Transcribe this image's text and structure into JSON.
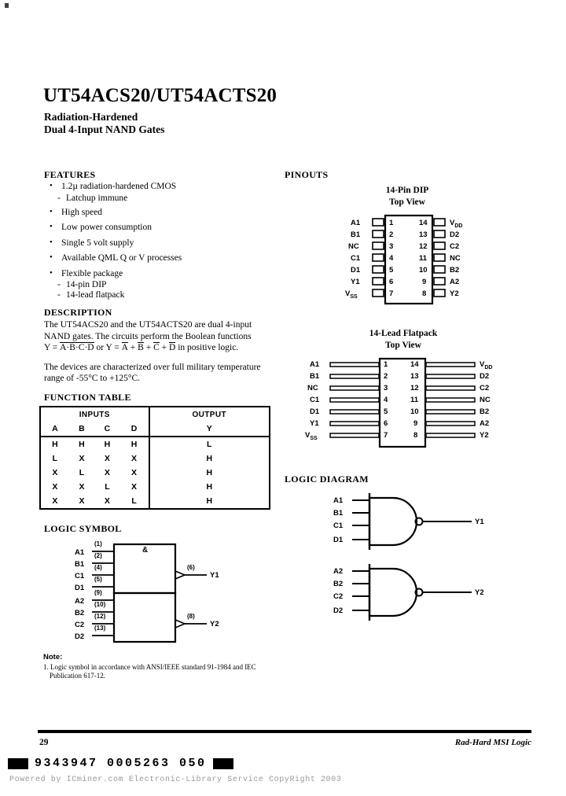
{
  "document": {
    "title": "UT54ACS20/UT54ACTS20",
    "subtitle_line1": "Radiation-Hardened",
    "subtitle_line2": "Dual 4-Input NAND Gates"
  },
  "features": {
    "heading": "FEATURES",
    "items": [
      {
        "text": "1.2µ radiation-hardened CMOS",
        "level": 0
      },
      {
        "text": "Latchup immune",
        "level": 1
      },
      {
        "text": "High speed",
        "level": 0
      },
      {
        "text": "Low power consumption",
        "level": 0
      },
      {
        "text": "Single 5 volt supply",
        "level": 0
      },
      {
        "text": "Available QML Q or V processes",
        "level": 0
      },
      {
        "text": "Flexible package",
        "level": 0
      },
      {
        "text": "14-pin DIP",
        "level": 1
      },
      {
        "text": "14-lead flatpack",
        "level": 1
      }
    ],
    "bullet_glyph": "•",
    "dash_glyph": "-"
  },
  "description": {
    "heading": "DESCRIPTION",
    "paragraph1_part1": "The UT54ACS20 and the UT54ACTS20 are dual 4-input NAND gates. The circuits perform the Boolean functions",
    "equation_prefix": "Y = ",
    "equation_term1": "A·B·C·D",
    "equation_middle": " or Y = ",
    "equation_a": "A",
    "equation_b": "B",
    "equation_c": "C",
    "equation_d": "D",
    "equation_plus": " + ",
    "equation_suffix": " in positive logic.",
    "paragraph2": "The devices are characterized over full military temperature range of -55°C to +125°C."
  },
  "function_table": {
    "heading": "FUNCTION TABLE",
    "group_inputs": "INPUTS",
    "group_output": "OUTPUT",
    "columns": [
      "A",
      "B",
      "C",
      "D"
    ],
    "output_column": "Y",
    "rows": [
      {
        "inputs": [
          "H",
          "H",
          "H",
          "H"
        ],
        "output": "L"
      },
      {
        "inputs": [
          "L",
          "X",
          "X",
          "X"
        ],
        "output": "H"
      },
      {
        "inputs": [
          "X",
          "L",
          "X",
          "X"
        ],
        "output": "H"
      },
      {
        "inputs": [
          "X",
          "X",
          "L",
          "X"
        ],
        "output": "H"
      },
      {
        "inputs": [
          "X",
          "X",
          "X",
          "L"
        ],
        "output": "H"
      }
    ]
  },
  "pinouts": {
    "heading": "PINOUTS",
    "dip": {
      "title": "14-Pin DIP",
      "view": "Top View",
      "left_pins": [
        {
          "number": "1",
          "label": "A1"
        },
        {
          "number": "2",
          "label": "B1"
        },
        {
          "number": "3",
          "label": "NC"
        },
        {
          "number": "4",
          "label": "C1"
        },
        {
          "number": "5",
          "label": "D1"
        },
        {
          "number": "6",
          "label": "Y1"
        },
        {
          "number": "7",
          "label": "V",
          "sub": "SS"
        }
      ],
      "right_pins": [
        {
          "number": "14",
          "label": "V",
          "sub": "DD"
        },
        {
          "number": "13",
          "label": "D2"
        },
        {
          "number": "12",
          "label": "C2"
        },
        {
          "number": "11",
          "label": "NC"
        },
        {
          "number": "10",
          "label": "B2"
        },
        {
          "number": "9",
          "label": "A2"
        },
        {
          "number": "8",
          "label": "Y2"
        }
      ]
    },
    "flatpack": {
      "title": "14-Lead Flatpack",
      "view": "Top View",
      "left_pins": [
        {
          "number": "1",
          "label": "A1"
        },
        {
          "number": "2",
          "label": "B1"
        },
        {
          "number": "3",
          "label": "NC"
        },
        {
          "number": "4",
          "label": "C1"
        },
        {
          "number": "5",
          "label": "D1"
        },
        {
          "number": "6",
          "label": "Y1"
        },
        {
          "number": "7",
          "label": "V",
          "sub": "SS"
        }
      ],
      "right_pins": [
        {
          "number": "14",
          "label": "V",
          "sub": "DD"
        },
        {
          "number": "13",
          "label": "D2"
        },
        {
          "number": "12",
          "label": "C2"
        },
        {
          "number": "11",
          "label": "NC"
        },
        {
          "number": "10",
          "label": "B2"
        },
        {
          "number": "9",
          "label": "A2"
        },
        {
          "number": "8",
          "label": "Y2"
        }
      ]
    }
  },
  "logic_diagram": {
    "heading": "LOGIC DIAGRAM",
    "gates": [
      {
        "inputs": [
          "A1",
          "B1",
          "C1",
          "D1"
        ],
        "output": "Y1"
      },
      {
        "inputs": [
          "A2",
          "B2",
          "C2",
          "D2"
        ],
        "output": "Y2"
      }
    ]
  },
  "logic_symbol": {
    "heading": "LOGIC SYMBOL",
    "qualifier": "&",
    "blocks": [
      {
        "inputs": [
          {
            "label": "A1",
            "pin": "(1)"
          },
          {
            "label": "B1",
            "pin": "(2)"
          },
          {
            "label": "C1",
            "pin": "(4)"
          },
          {
            "label": "D1",
            "pin": "(5)"
          }
        ],
        "output": {
          "label": "Y1",
          "pin": "(6)"
        }
      },
      {
        "inputs": [
          {
            "label": "A2",
            "pin": "(9)"
          },
          {
            "label": "B2",
            "pin": "(10)"
          },
          {
            "label": "C2",
            "pin": "(12)"
          },
          {
            "label": "D2",
            "pin": "(13)"
          }
        ],
        "output": {
          "label": "Y2",
          "pin": "(8)"
        }
      }
    ]
  },
  "note": {
    "title": "Note:",
    "item1": "1. Logic symbol in accordance with ANSI/IEEE standard 91-1984 and IEC Publication 617-12."
  },
  "footer": {
    "page_number": "29",
    "series": "Rad-Hard MSI Logic",
    "barcode_text": "9343947 0005263 050",
    "scan_watermark": "Powered by ICminer.com Electronic-Library Service CopyRight 2003"
  }
}
